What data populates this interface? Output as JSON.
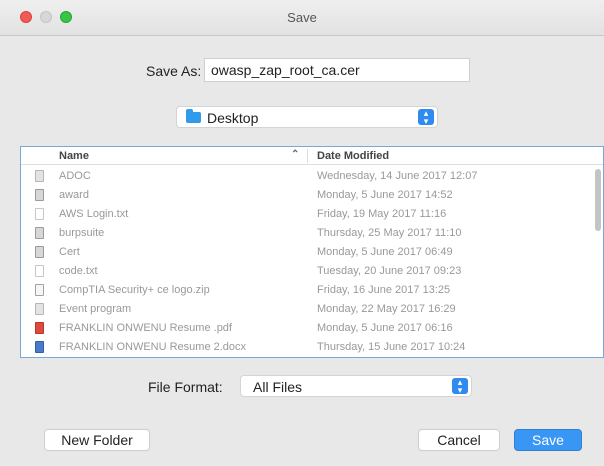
{
  "window": {
    "title": "Save"
  },
  "save_as": {
    "label": "Save As:",
    "value": "owasp_zap_root_ca.cer"
  },
  "location": {
    "value": "Desktop",
    "icon": "folder-icon"
  },
  "file_list": {
    "columns": {
      "name": "Name",
      "date_modified": "Date Modified"
    },
    "sort": "ascending",
    "rows": [
      {
        "name": "ADOC",
        "date": "Wednesday, 14 June 2017 12:07",
        "icon": "document-icon"
      },
      {
        "name": "award",
        "date": "Monday, 5 June 2017 14:52",
        "icon": "executable-icon"
      },
      {
        "name": "AWS Login.txt",
        "date": "Friday, 19 May 2017 11:16",
        "icon": "text-file-icon"
      },
      {
        "name": "burpsuite",
        "date": "Thursday, 25 May 2017 11:10",
        "icon": "executable-icon"
      },
      {
        "name": "Cert",
        "date": "Monday, 5 June 2017 06:49",
        "icon": "executable-icon"
      },
      {
        "name": "code.txt",
        "date": "Tuesday, 20 June 2017 09:23",
        "icon": "text-file-icon"
      },
      {
        "name": "CompTIA Security+ ce logo.zip",
        "date": "Friday, 16 June 2017 13:25",
        "icon": "zip-icon"
      },
      {
        "name": "Event program",
        "date": "Monday, 22 May 2017 16:29",
        "icon": "document-icon"
      },
      {
        "name": "FRANKLIN ONWENU Resume .pdf",
        "date": "Monday, 5 June 2017 06:16",
        "icon": "pdf-icon"
      },
      {
        "name": "FRANKLIN ONWENU Resume 2.docx",
        "date": "Thursday, 15 June 2017 10:24",
        "icon": "docx-icon"
      }
    ]
  },
  "file_format": {
    "label": "File Format:",
    "value": "All Files"
  },
  "buttons": {
    "new_folder": "New Folder",
    "cancel": "Cancel",
    "save": "Save"
  },
  "colors": {
    "accent": "#3a96f5",
    "close": "#f25a53",
    "maximize": "#37c447",
    "list_border": "#7aa7d8"
  }
}
